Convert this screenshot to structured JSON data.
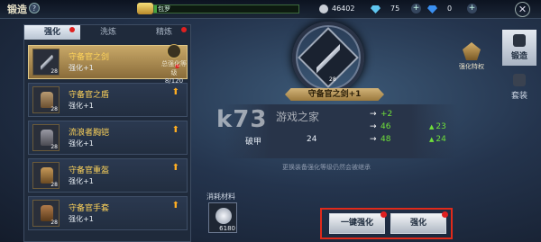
{
  "header": {
    "title": "锻造",
    "help_symbol": "?",
    "vip_label": "包罗",
    "vip_fraction": 0.02,
    "silver": "46402",
    "diamond": "75",
    "blue_gem": "0",
    "add_symbol": "+",
    "close_symbol": "✕"
  },
  "tabs": [
    {
      "label": "强化",
      "active": true,
      "dot": true
    },
    {
      "label": "洗炼",
      "active": false,
      "dot": false
    },
    {
      "label": "精炼",
      "active": false,
      "dot": true
    }
  ],
  "items": [
    {
      "name": "守备官之剑",
      "level": "强化+1",
      "lv_badge": "28",
      "selected": true
    },
    {
      "name": "守备官之盾",
      "level": "强化+1",
      "lv_badge": "28",
      "selected": false
    },
    {
      "name": "流浪者胸铠",
      "level": "强化+1",
      "lv_badge": "28",
      "selected": false
    },
    {
      "name": "守备官重盔",
      "level": "强化+1",
      "lv_badge": "28",
      "selected": false
    },
    {
      "name": "守备官手套",
      "level": "强化+1",
      "lv_badge": "28",
      "selected": false
    }
  ],
  "total": {
    "label": "总强化等级",
    "value": "8/120"
  },
  "weapon": {
    "name": "守备官之剑+1",
    "lv": "28"
  },
  "stats": [
    {
      "label": "",
      "current": "",
      "gain": "+2",
      "next": ""
    },
    {
      "label": "",
      "current": "",
      "gain": "46",
      "next": "23"
    },
    {
      "label": "破甲",
      "current": "24",
      "gain": "48",
      "next": "24"
    }
  ],
  "hint": "更换装备强化等级仍然会被继承",
  "material": {
    "label": "消耗材料",
    "count": "6180"
  },
  "buttons": {
    "one_key": "一键强化",
    "enhance": "强化"
  },
  "right_tabs": [
    {
      "label": "锻造",
      "active": true
    },
    {
      "label": "套装",
      "active": false
    }
  ],
  "privilege": "强化特权",
  "watermark": {
    "main": "k73",
    "sub": "游戏之家"
  },
  "colors": {
    "accent": "#ffd45a",
    "highlight": "#e02a1a",
    "green": "#6fe03a"
  }
}
